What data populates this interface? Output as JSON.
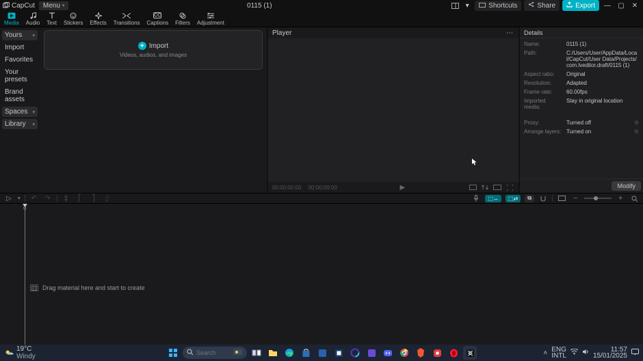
{
  "titlebar": {
    "app_name": "CapCut",
    "menu_label": "Menu",
    "project_title": "0115 (1)",
    "shortcuts_label": "Shortcuts",
    "share_label": "Share",
    "export_label": "Export"
  },
  "ribbon": {
    "items": [
      {
        "name": "media",
        "label": "Media",
        "active": true
      },
      {
        "name": "audio",
        "label": "Audio"
      },
      {
        "name": "text",
        "label": "Text"
      },
      {
        "name": "stickers",
        "label": "Stickers"
      },
      {
        "name": "effects",
        "label": "Effects"
      },
      {
        "name": "transitions",
        "label": "Transitions"
      },
      {
        "name": "captions",
        "label": "Captions"
      },
      {
        "name": "filters",
        "label": "Filters"
      },
      {
        "name": "adjustment",
        "label": "Adjustment"
      }
    ]
  },
  "sidebar": {
    "items": [
      {
        "label": "Yours",
        "selected": true,
        "chev": true
      },
      {
        "label": "Import",
        "active": true
      },
      {
        "label": "Favorites"
      },
      {
        "label": "Your presets"
      },
      {
        "label": "Brand assets"
      },
      {
        "label": "Spaces",
        "selected": true,
        "chev": true
      },
      {
        "label": "Library",
        "selected": true,
        "chev": true
      }
    ]
  },
  "import_box": {
    "title": "Import",
    "subtitle": "Videos, audios, and images"
  },
  "player": {
    "header": "Player",
    "time_current": "00:00:00:00",
    "time_total": "00:00:00:00"
  },
  "details": {
    "header": "Details",
    "rows": [
      {
        "k": "Name:",
        "v": "0115 (1)"
      },
      {
        "k": "Path:",
        "v": "C:/Users/User/AppData/Local/CapCut/User Data/Projects/com.lveditor.draft/0115 (1)"
      },
      {
        "k": "Aspect ratio:",
        "v": "Original"
      },
      {
        "k": "Resolution:",
        "v": "Adapted"
      },
      {
        "k": "Frame rate:",
        "v": "60.00fps"
      },
      {
        "k": "Imported media:",
        "v": "Stay in original location"
      },
      {
        "k": "Proxy:",
        "v": "Turned off",
        "act": true
      },
      {
        "k": "Arrange layers:",
        "v": "Turned on",
        "act": true
      }
    ],
    "modify_label": "Modify"
  },
  "timeline": {
    "ruler_start": "0",
    "hint": "Drag material here and start to create"
  },
  "taskbar": {
    "weather_temp": "19°C",
    "weather_desc": "Windy",
    "search_placeholder": "Search",
    "lang1": "ENG",
    "lang2": "INTL",
    "time": "11:57",
    "date": "15/01/2025"
  }
}
